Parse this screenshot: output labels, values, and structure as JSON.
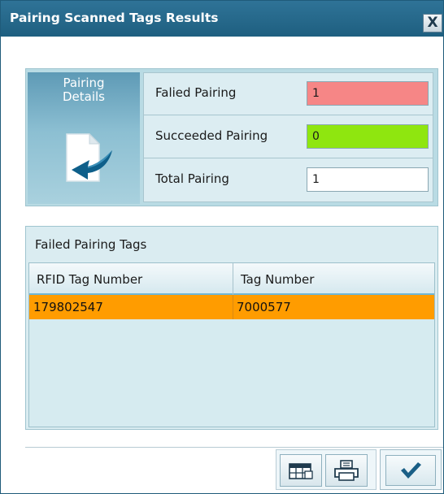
{
  "window": {
    "title": "Pairing Scanned Tags Results",
    "close_label": "X"
  },
  "details": {
    "tile_label": "Pairing\nDetails",
    "rows": [
      {
        "label": "Falied Pairing",
        "value": "1",
        "color": "#f68686"
      },
      {
        "label": "Succeeded Pairing",
        "value": "0",
        "color": "#8fe60f"
      },
      {
        "label": "Total Pairing",
        "value": "1",
        "color": "#ffffff"
      }
    ]
  },
  "failed_tags": {
    "title": "Failed Pairing Tags",
    "columns": [
      "RFID Tag Number",
      "Tag Number"
    ],
    "rows": [
      {
        "rfid": "179802547",
        "tag": "7000577"
      }
    ],
    "selected_row_color": "#ff9c00"
  },
  "icons": {
    "export": "table-export-icon",
    "print": "printer-icon",
    "ok": "checkmark-icon",
    "details": "document-arrow-icon"
  }
}
